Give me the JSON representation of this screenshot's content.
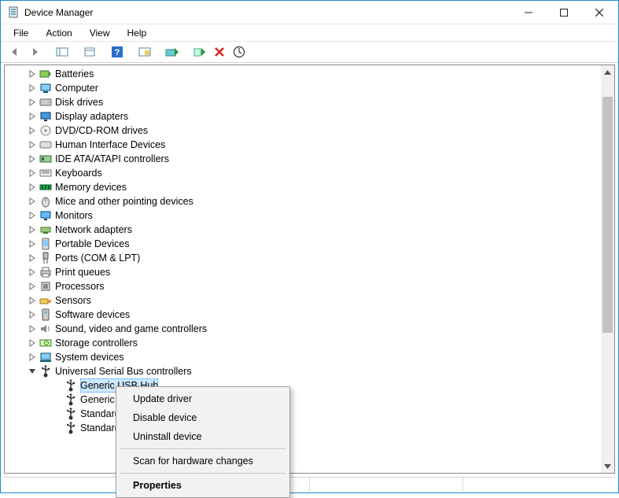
{
  "window": {
    "title": "Device Manager"
  },
  "menu": {
    "file": "File",
    "action": "Action",
    "view": "View",
    "help": "Help"
  },
  "tree": {
    "items": [
      {
        "label": "Batteries",
        "icon": "battery-icon"
      },
      {
        "label": "Computer",
        "icon": "computer-icon"
      },
      {
        "label": "Disk drives",
        "icon": "disk-icon"
      },
      {
        "label": "Display adapters",
        "icon": "display-icon"
      },
      {
        "label": "DVD/CD-ROM drives",
        "icon": "optical-icon"
      },
      {
        "label": "Human Interface Devices",
        "icon": "hid-icon"
      },
      {
        "label": "IDE ATA/ATAPI controllers",
        "icon": "ide-icon"
      },
      {
        "label": "Keyboards",
        "icon": "keyboard-icon"
      },
      {
        "label": "Memory devices",
        "icon": "memory-icon"
      },
      {
        "label": "Mice and other pointing devices",
        "icon": "mouse-icon"
      },
      {
        "label": "Monitors",
        "icon": "monitor-icon"
      },
      {
        "label": "Network adapters",
        "icon": "network-icon"
      },
      {
        "label": "Portable Devices",
        "icon": "portable-icon"
      },
      {
        "label": "Ports (COM & LPT)",
        "icon": "ports-icon"
      },
      {
        "label": "Print queues",
        "icon": "printer-icon"
      },
      {
        "label": "Processors",
        "icon": "cpu-icon"
      },
      {
        "label": "Sensors",
        "icon": "sensor-icon"
      },
      {
        "label": "Software devices",
        "icon": "software-icon"
      },
      {
        "label": "Sound, video and game controllers",
        "icon": "sound-icon"
      },
      {
        "label": "Storage controllers",
        "icon": "storage-icon"
      },
      {
        "label": "System devices",
        "icon": "system-icon"
      }
    ],
    "expanded": {
      "label": "Universal Serial Bus controllers",
      "icon": "usb-icon",
      "children": [
        {
          "label": "Generic USB Hub",
          "icon": "usb-device-icon",
          "selected": true
        },
        {
          "label": "Generic USB Hub",
          "icon": "usb-device-icon"
        },
        {
          "label": "Standard Enhanced PCI to USB Host Controller",
          "icon": "usb-device-icon"
        },
        {
          "label": "Standard Enhanced PCI to USB Host Controller",
          "icon": "usb-device-icon"
        }
      ]
    }
  },
  "context_menu": {
    "items": [
      {
        "label": "Update driver"
      },
      {
        "label": "Disable device"
      },
      {
        "label": "Uninstall device"
      }
    ],
    "items2": [
      {
        "label": "Scan for hardware changes"
      }
    ],
    "items3": [
      {
        "label": "Properties",
        "bold": true
      }
    ]
  }
}
